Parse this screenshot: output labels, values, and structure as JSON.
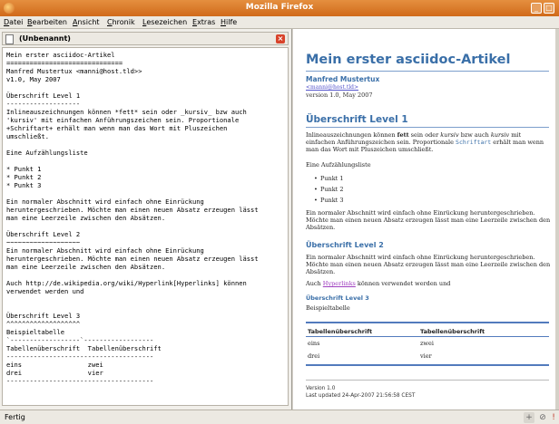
{
  "window": {
    "title": "Mozilla Firefox"
  },
  "menu": [
    "Datei",
    "Bearbeiten",
    "Ansicht",
    "Chronik",
    "Lesezeichen",
    "Extras",
    "Hilfe"
  ],
  "editor": {
    "doc_title": "(Unbenannt)",
    "source": "Mein erster asciidoc-Artikel\n==============================\nManfred Mustertux <manni@host.tld>>\nv1.0, May 2007\n\nÜberschrift Level 1\n-------------------\nInlineauszeichnungen können *fett* sein oder _kursiv_ bzw auch\n'kursiv' mit einfachen Anführungszeichen sein. Proportionale\n+Schriftart+ erhält man wenn man das Wort mit Pluszeichen\numschließt.\n\nEine Aufzählungsliste\n\n* Punkt 1\n* Punkt 2\n* Punkt 3\n\nEin normaler Abschnitt wird einfach ohne Einrückung\nheruntergeschrieben. Möchte man einen neuen Absatz erzeugen lässt\nman eine Leerzeile zwischen den Absätzen.\n\nÜberschrift Level 2\n~~~~~~~~~~~~~~~~~~~\nEin normaler Abschnitt wird einfach ohne Einrückung\nheruntergeschrieben. Möchte man einen neuen Absatz erzeugen lässt\nman eine Leerzeile zwischen den Absätzen.\n\nAuch http://de.wikipedia.org/wiki/Hyperlink[Hyperlinks] können\nverwendet werden und\n\n\nÜberschrift Level 3\n^^^^^^^^^^^^^^^^^^^\nBeispieltabelle\n`------------------`------------------\nTabellenüberschrift  Tabellenüberschrift\n--------------------------------------\neins                 zwei\ndrei                 vier\n--------------------------------------"
  },
  "preview": {
    "title": "Mein erster asciidoc-Artikel",
    "author": "Manfred Mustertux",
    "email": "<manni@host.tld>",
    "version": "version 1.0, May 2007",
    "h1": "Überschrift Level 1",
    "p1_a": "Inlineauszeichnungen können ",
    "p1_bold": "fett",
    "p1_b": " sein oder ",
    "p1_it1": "kursiv",
    "p1_c": " bzw auch ",
    "p1_it2": "kursiv",
    "p1_d": " mit einfachen Anführungszeichen sein. Proportionale ",
    "p1_mono": "Schriftart",
    "p1_e": " erhält man wenn man das Wort mit Pluszeichen umschließt.",
    "list_intro": "Eine Aufzählungsliste",
    "list": [
      "Punkt 1",
      "Punkt 2",
      "Punkt 3"
    ],
    "p2": "Ein normaler Abschnitt wird einfach ohne Einrückung heruntergeschrieben. Möchte man einen neuen Absatz erzeugen lässt man eine Leerzeile zwischen den Absätzen.",
    "h2": "Überschrift Level 2",
    "p3": "Ein normaler Abschnitt wird einfach ohne Einrückung heruntergeschrieben. Möchte man einen neuen Absatz erzeugen lässt man eine Leerzeile zwischen den Absätzen.",
    "p4_a": "Auch ",
    "p4_link": "Hyperlinks",
    "p4_b": " können verwendet werden und",
    "h3": "Überschrift Level 3",
    "table_caption": "Beispieltabelle",
    "table": {
      "headers": [
        "Tabellenüberschrift",
        "Tabellenüberschrift"
      ],
      "rows": [
        [
          "eins",
          "zwei"
        ],
        [
          "drei",
          "vier"
        ]
      ]
    },
    "footer_version": "Version 1.0",
    "footer_updated": "Last updated 24-Apr-2007 21:56:58 CEST"
  },
  "status": {
    "text": "Fertig"
  }
}
